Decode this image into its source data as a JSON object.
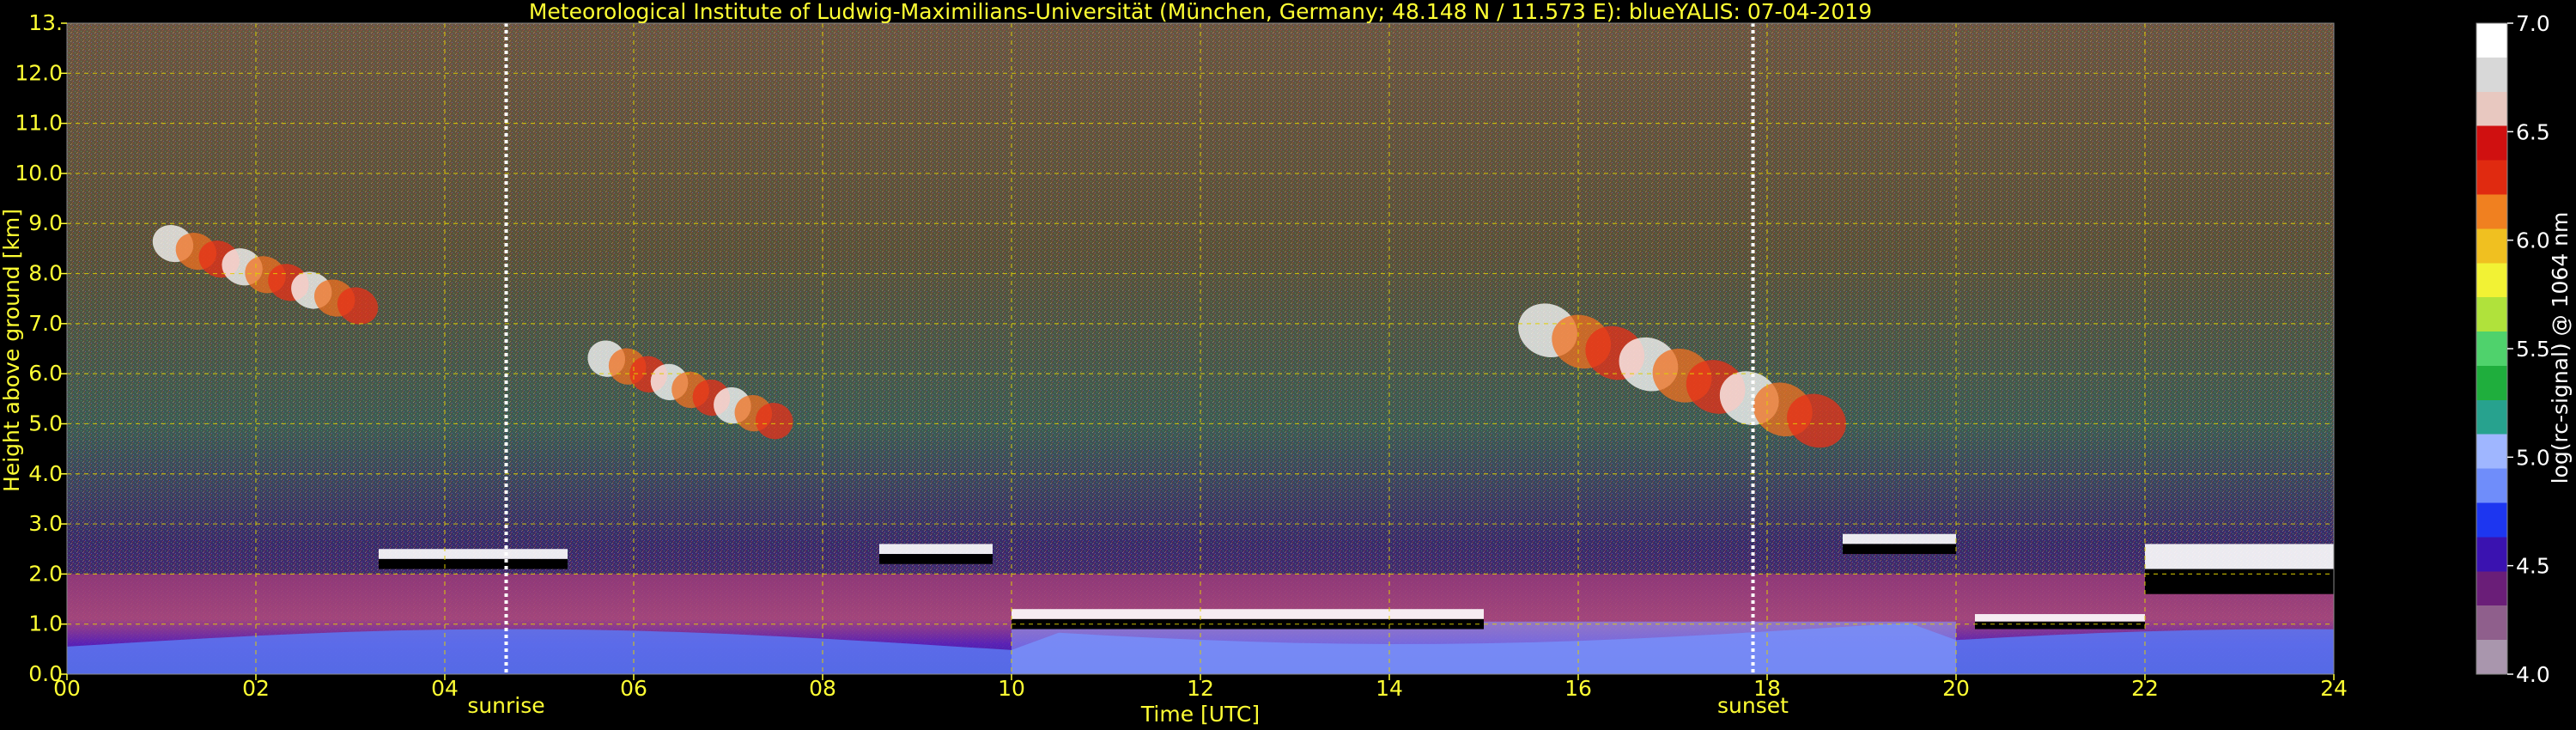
{
  "chart_data": {
    "type": "heatmap",
    "title": "Meteorological Institute of Ludwig-Maximilians-Universität (München, Germany; 48.148 N / 11.573 E):    blueYALIS: 07-04-2019",
    "xlabel": "Time [UTC]",
    "ylabel": "Height above ground [km]",
    "xlim": [
      0,
      24
    ],
    "ylim": [
      0,
      13
    ],
    "x_ticks": [
      "00",
      "02",
      "04",
      "06",
      "08",
      "10",
      "12",
      "14",
      "16",
      "18",
      "20",
      "22",
      "24"
    ],
    "y_ticks": [
      "0.0",
      "1.0",
      "2.0",
      "3.0",
      "4.0",
      "5.0",
      "6.0",
      "7.0",
      "8.0",
      "9.0",
      "10.0",
      "11.0",
      "12.0",
      "13."
    ],
    "grid": true,
    "markers": [
      {
        "label": "sunrise",
        "time": 4.65
      },
      {
        "label": "sunset",
        "time": 17.85
      }
    ],
    "colorbar": {
      "label": "log(rc-signal) @ 1064 nm",
      "range": [
        4.0,
        7.0
      ],
      "ticks": [
        "4.0",
        "4.5",
        "5.0",
        "5.5",
        "6.0",
        "6.5",
        "7.0"
      ]
    },
    "features": [
      {
        "name": "cirrus",
        "t0": 1.0,
        "t1": 3.2,
        "h0": 6.9,
        "h1": 8.9
      },
      {
        "name": "cirrus",
        "t0": 5.6,
        "t1": 7.6,
        "h0": 4.6,
        "h1": 6.6
      },
      {
        "name": "cirrus",
        "t0": 15.5,
        "t1": 18.7,
        "h0": 4.4,
        "h1": 7.3
      },
      {
        "name": "cloud layer",
        "t0": 3.3,
        "t1": 5.3,
        "h0": 2.1,
        "h1": 2.5
      },
      {
        "name": "cloud layer",
        "t0": 8.6,
        "t1": 9.8,
        "h0": 2.2,
        "h1": 2.6
      },
      {
        "name": "cloud layer",
        "t0": 10.0,
        "t1": 15.0,
        "h0": 0.9,
        "h1": 1.3
      },
      {
        "name": "cloud layer",
        "t0": 18.8,
        "t1": 20.0,
        "h0": 2.4,
        "h1": 2.8
      },
      {
        "name": "cloud layer",
        "t0": 20.2,
        "t1": 22.0,
        "h0": 0.9,
        "h1": 1.2
      },
      {
        "name": "cloud layer",
        "t0": 22.0,
        "t1": 24.0,
        "h0": 1.6,
        "h1": 2.6
      }
    ]
  },
  "colors": {
    "text": "#ffff33",
    "grid": "#e0d000",
    "sun_line": "#ffffff",
    "colorbar": [
      "#a996ad",
      "#8f5f8c",
      "#6a1e78",
      "#3a12b0",
      "#1d36f0",
      "#6f8dfa",
      "#9fb6ff",
      "#27a28e",
      "#1fae3d",
      "#4fd26c",
      "#b0e23b",
      "#f2f234",
      "#f0c020",
      "#f08020",
      "#e02a10",
      "#d01010",
      "#e8c8c0",
      "#d8d8d8",
      "#ffffff"
    ]
  }
}
